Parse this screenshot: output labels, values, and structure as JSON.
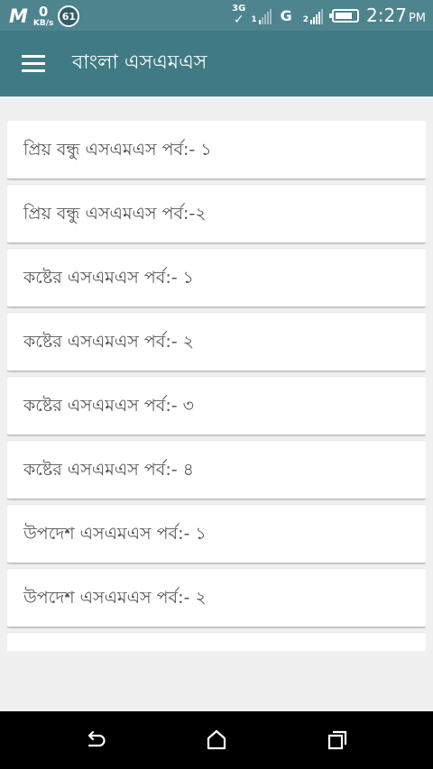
{
  "status_bar": {
    "app_icon_letter": "M",
    "net_speed_value": "0",
    "net_speed_unit": "KB/s",
    "notification_count": "61",
    "network_type_1": "3G",
    "signal_1_tag": "1",
    "network_type_2": "G",
    "signal_2_tag": "2",
    "time": "2:27",
    "ampm": "PM"
  },
  "app_bar": {
    "title": "বাংলা এসএমএস"
  },
  "list": {
    "items": [
      {
        "label": "প্রিয় বন্ধু এসএমএস পর্ব:- ১"
      },
      {
        "label": "প্রিয় বন্ধু এসএমএস পর্ব:-২"
      },
      {
        "label": "কষ্টের এসএমএস পর্ব:- ১"
      },
      {
        "label": "কষ্টের এসএমএস পর্ব:- ২"
      },
      {
        "label": "কষ্টের এসএমএস পর্ব:- ৩"
      },
      {
        "label": "কষ্টের এসএমএস পর্ব:- ৪"
      },
      {
        "label": "উপদেশ এসএমএস পর্ব:- ১"
      },
      {
        "label": "উপদেশ এসএমএস পর্ব:- ২"
      },
      {
        "label": ""
      }
    ]
  },
  "nav_bar": {
    "icons": [
      "back-icon",
      "home-icon",
      "recents-icon"
    ]
  },
  "colors": {
    "status_bar": "#4d848e",
    "app_bar": "#3f7a85",
    "background": "#f0f0f0",
    "card": "#ffffff",
    "item_text": "#555555",
    "nav_bar": "#000000"
  }
}
